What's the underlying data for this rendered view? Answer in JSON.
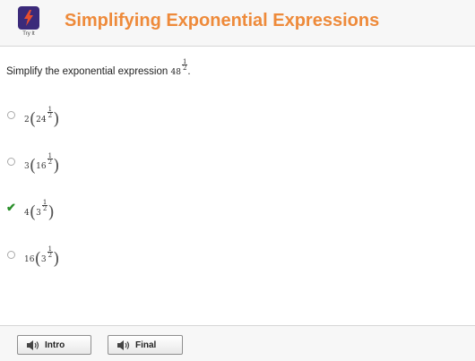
{
  "header": {
    "logo_caption": "Try It",
    "title": "Simplifying Exponential Expressions"
  },
  "question": {
    "prompt": "Simplify the exponential expression",
    "base": "48",
    "exp_num": "1",
    "exp_den": "2",
    "end": "."
  },
  "choices": [
    {
      "coef": "2",
      "base": "24",
      "exp_num": "1",
      "exp_den": "2",
      "state": "unselected"
    },
    {
      "coef": "3",
      "base": "16",
      "exp_num": "1",
      "exp_den": "2",
      "state": "unselected"
    },
    {
      "coef": "4",
      "base": "3",
      "exp_num": "1",
      "exp_den": "2",
      "state": "correct"
    },
    {
      "coef": "16",
      "base": "3",
      "exp_num": "1",
      "exp_den": "2",
      "state": "unselected"
    }
  ],
  "footer": {
    "intro_label": "Intro",
    "final_label": "Final"
  },
  "colors": {
    "title": "#ee8a3a",
    "logo_bg": "#3b2a7a",
    "check": "#2a8f2a"
  },
  "icons": [
    "lightning-logo-icon",
    "radio-icon",
    "checkmark-icon",
    "speaker-icon"
  ]
}
